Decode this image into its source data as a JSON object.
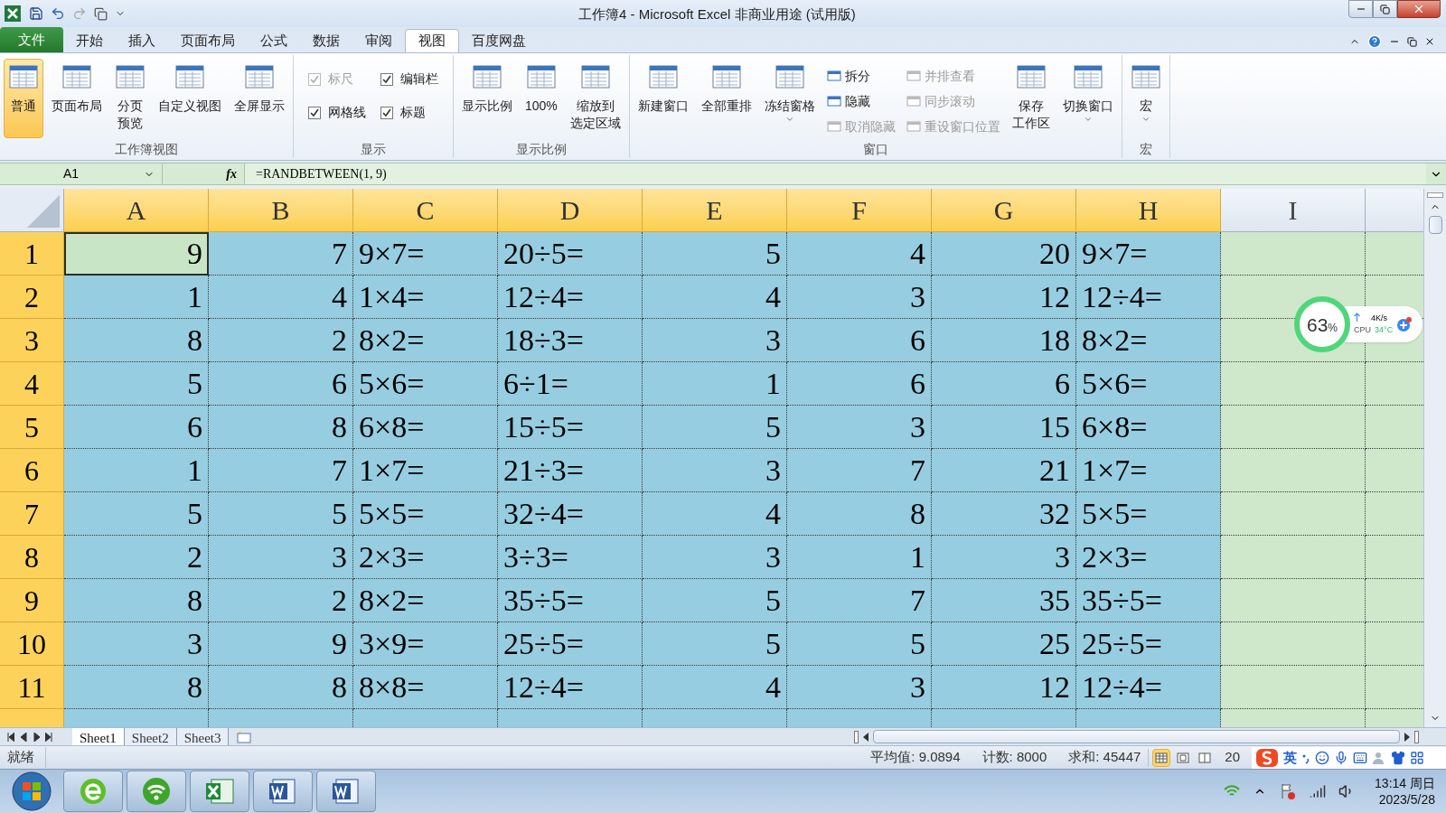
{
  "window": {
    "title": "工作簿4 - Microsoft Excel 非商业用途 (试用版)"
  },
  "file_tab": {
    "label": "文件"
  },
  "tabs": [
    {
      "label": "开始",
      "selected": false
    },
    {
      "label": "插入",
      "selected": false
    },
    {
      "label": "页面布局",
      "selected": false
    },
    {
      "label": "公式",
      "selected": false
    },
    {
      "label": "数据",
      "selected": false
    },
    {
      "label": "审阅",
      "selected": false
    },
    {
      "label": "视图",
      "selected": true
    },
    {
      "label": "百度网盘",
      "selected": false
    }
  ],
  "ribbon": {
    "groups": [
      {
        "label": "工作簿视图",
        "items": [
          {
            "kind": "large",
            "label": "普通",
            "selected": true
          },
          {
            "kind": "large",
            "label": "页面布局",
            "selected": false
          },
          {
            "kind": "large",
            "lines": [
              "分页",
              "预览"
            ],
            "selected": false
          },
          {
            "kind": "large",
            "label": "自定义视图",
            "selected": false
          },
          {
            "kind": "large",
            "label": "全屏显示",
            "selected": false
          }
        ]
      },
      {
        "label": "显示",
        "items": [
          {
            "kind": "checks",
            "items": [
              {
                "label": "标尺",
                "checked": true,
                "disabled": true
              },
              {
                "label": "编辑栏",
                "checked": true,
                "disabled": false
              },
              {
                "label": "网格线",
                "checked": true,
                "disabled": false
              },
              {
                "label": "标题",
                "checked": true,
                "disabled": false
              }
            ]
          }
        ]
      },
      {
        "label": "显示比例",
        "items": [
          {
            "kind": "large",
            "label": "显示比例"
          },
          {
            "kind": "large",
            "label": "100%"
          },
          {
            "kind": "large",
            "lines": [
              "缩放到",
              "选定区域"
            ]
          }
        ]
      },
      {
        "label": "窗口",
        "items": [
          {
            "kind": "large",
            "label": "新建窗口"
          },
          {
            "kind": "large",
            "label": "全部重排"
          },
          {
            "kind": "large",
            "label": "冻结窗格",
            "dropdown": true
          },
          {
            "kind": "stack",
            "items": [
              {
                "label": "拆分",
                "disabled": false
              },
              {
                "label": "隐藏",
                "disabled": false
              },
              {
                "label": "取消隐藏",
                "disabled": true
              }
            ]
          },
          {
            "kind": "stack",
            "items": [
              {
                "label": "并排查看",
                "disabled": true
              },
              {
                "label": "同步滚动",
                "disabled": true
              },
              {
                "label": "重设窗口位置",
                "disabled": true
              }
            ]
          },
          {
            "kind": "large",
            "lines": [
              "保存",
              "工作区"
            ]
          },
          {
            "kind": "large",
            "label": "切换窗口",
            "dropdown": true
          }
        ]
      },
      {
        "label": "宏",
        "items": [
          {
            "kind": "large",
            "label": "宏",
            "dropdown": true
          }
        ]
      }
    ]
  },
  "formula_bar": {
    "name_box": "A1",
    "function_label": "fx",
    "formula": "=RANDBETWEEN(1, 9)"
  },
  "sheet": {
    "columns": [
      {
        "label": "A",
        "selected": true,
        "kind": "number"
      },
      {
        "label": "B",
        "selected": true,
        "kind": "number"
      },
      {
        "label": "C",
        "selected": true,
        "kind": "text"
      },
      {
        "label": "D",
        "selected": true,
        "kind": "text"
      },
      {
        "label": "E",
        "selected": true,
        "kind": "number"
      },
      {
        "label": "F",
        "selected": true,
        "kind": "number"
      },
      {
        "label": "G",
        "selected": true,
        "kind": "number"
      },
      {
        "label": "H",
        "selected": true,
        "kind": "text"
      },
      {
        "label": "I",
        "selected": false,
        "kind": "number"
      }
    ],
    "rows": [
      {
        "header": "1",
        "selected": true,
        "cells": [
          {
            "text": "9",
            "active": true
          },
          {
            "text": "7",
            "active": false
          },
          {
            "text": "9×7=",
            "active": false
          },
          {
            "text": "20÷5=",
            "active": false
          },
          {
            "text": "5",
            "active": false
          },
          {
            "text": "4",
            "active": false
          },
          {
            "text": "20",
            "active": false
          },
          {
            "text": "9×7=",
            "active": false
          }
        ]
      },
      {
        "header": "2",
        "selected": true,
        "cells": [
          {
            "text": "1",
            "active": false
          },
          {
            "text": "4",
            "active": false
          },
          {
            "text": "1×4=",
            "active": false
          },
          {
            "text": "12÷4=",
            "active": false
          },
          {
            "text": "4",
            "active": false
          },
          {
            "text": "3",
            "active": false
          },
          {
            "text": "12",
            "active": false
          },
          {
            "text": "12÷4=",
            "active": false
          }
        ]
      },
      {
        "header": "3",
        "selected": true,
        "cells": [
          {
            "text": "8",
            "active": false
          },
          {
            "text": "2",
            "active": false
          },
          {
            "text": "8×2=",
            "active": false
          },
          {
            "text": "18÷3=",
            "active": false
          },
          {
            "text": "3",
            "active": false
          },
          {
            "text": "6",
            "active": false
          },
          {
            "text": "18",
            "active": false
          },
          {
            "text": "8×2=",
            "active": false
          }
        ]
      },
      {
        "header": "4",
        "selected": true,
        "cells": [
          {
            "text": "5",
            "active": false
          },
          {
            "text": "6",
            "active": false
          },
          {
            "text": "5×6=",
            "active": false
          },
          {
            "text": "6÷1=",
            "active": false
          },
          {
            "text": "1",
            "active": false
          },
          {
            "text": "6",
            "active": false
          },
          {
            "text": "6",
            "active": false
          },
          {
            "text": "5×6=",
            "active": false
          }
        ]
      },
      {
        "header": "5",
        "selected": true,
        "cells": [
          {
            "text": "6",
            "active": false
          },
          {
            "text": "8",
            "active": false
          },
          {
            "text": "6×8=",
            "active": false
          },
          {
            "text": "15÷5=",
            "active": false
          },
          {
            "text": "5",
            "active": false
          },
          {
            "text": "3",
            "active": false
          },
          {
            "text": "15",
            "active": false
          },
          {
            "text": "6×8=",
            "active": false
          }
        ]
      },
      {
        "header": "6",
        "selected": true,
        "cells": [
          {
            "text": "1",
            "active": false
          },
          {
            "text": "7",
            "active": false
          },
          {
            "text": "1×7=",
            "active": false
          },
          {
            "text": "21÷3=",
            "active": false
          },
          {
            "text": "3",
            "active": false
          },
          {
            "text": "7",
            "active": false
          },
          {
            "text": "21",
            "active": false
          },
          {
            "text": "1×7=",
            "active": false
          }
        ]
      },
      {
        "header": "7",
        "selected": true,
        "cells": [
          {
            "text": "5",
            "active": false
          },
          {
            "text": "5",
            "active": false
          },
          {
            "text": "5×5=",
            "active": false
          },
          {
            "text": "32÷4=",
            "active": false
          },
          {
            "text": "4",
            "active": false
          },
          {
            "text": "8",
            "active": false
          },
          {
            "text": "32",
            "active": false
          },
          {
            "text": "5×5=",
            "active": false
          }
        ]
      },
      {
        "header": "8",
        "selected": true,
        "cells": [
          {
            "text": "2",
            "active": false
          },
          {
            "text": "3",
            "active": false
          },
          {
            "text": "2×3=",
            "active": false
          },
          {
            "text": "3÷3=",
            "active": false
          },
          {
            "text": "3",
            "active": false
          },
          {
            "text": "1",
            "active": false
          },
          {
            "text": "3",
            "active": false
          },
          {
            "text": "2×3=",
            "active": false
          }
        ]
      },
      {
        "header": "9",
        "selected": true,
        "cells": [
          {
            "text": "8",
            "active": false
          },
          {
            "text": "2",
            "active": false
          },
          {
            "text": "8×2=",
            "active": false
          },
          {
            "text": "35÷5=",
            "active": false
          },
          {
            "text": "5",
            "active": false
          },
          {
            "text": "7",
            "active": false
          },
          {
            "text": "35",
            "active": false
          },
          {
            "text": "35÷5=",
            "active": false
          }
        ]
      },
      {
        "header": "10",
        "selected": true,
        "cells": [
          {
            "text": "3",
            "active": false
          },
          {
            "text": "9",
            "active": false
          },
          {
            "text": "3×9=",
            "active": false
          },
          {
            "text": "25÷5=",
            "active": false
          },
          {
            "text": "5",
            "active": false
          },
          {
            "text": "5",
            "active": false
          },
          {
            "text": "25",
            "active": false
          },
          {
            "text": "25÷5=",
            "active": false
          }
        ]
      },
      {
        "header": "11",
        "selected": true,
        "cells": [
          {
            "text": "8",
            "active": false
          },
          {
            "text": "8",
            "active": false
          },
          {
            "text": "8×8=",
            "active": false
          },
          {
            "text": "12÷4=",
            "active": false
          },
          {
            "text": "4",
            "active": false
          },
          {
            "text": "3",
            "active": false
          },
          {
            "text": "12",
            "active": false
          },
          {
            "text": "12÷4=",
            "active": false
          }
        ]
      }
    ]
  },
  "sheet_tabs": [
    {
      "label": "Sheet1",
      "selected": true
    },
    {
      "label": "Sheet2",
      "selected": false
    },
    {
      "label": "Sheet3",
      "selected": false
    }
  ],
  "status_bar": {
    "ready": "就绪",
    "average": "平均值: 9.0894",
    "count": "计数: 8000",
    "sum": "求和: 45447",
    "zoom": "20",
    "views": [
      {
        "selected": true
      },
      {
        "selected": false
      },
      {
        "selected": false
      }
    ]
  },
  "ime": {
    "mode": "英"
  },
  "monitor_widget": {
    "percent": "63",
    "unit": "%",
    "speed": "4K/s",
    "cpu_label": "CPU",
    "cpu_temp": "34°C"
  },
  "taskbar": {
    "time": "13:14 周日",
    "date": "2023/5/28"
  }
}
